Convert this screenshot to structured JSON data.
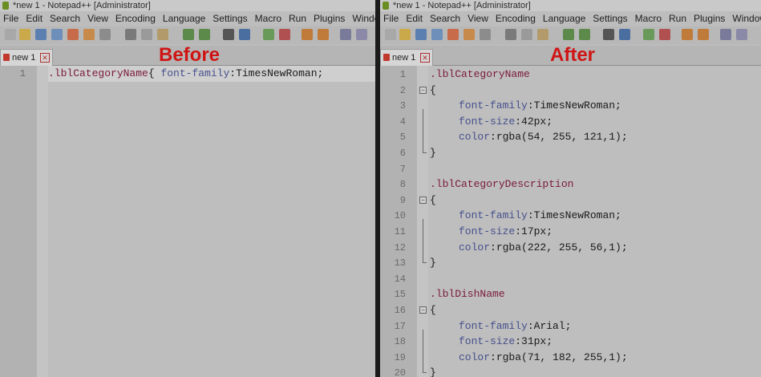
{
  "left": {
    "title": "*new  1 - Notepad++ [Administrator]",
    "menus": [
      "File",
      "Edit",
      "Search",
      "View",
      "Encoding",
      "Language",
      "Settings",
      "Macro",
      "Run",
      "Plugins",
      "Window"
    ],
    "tab": {
      "label": "new  1",
      "close": "✕"
    },
    "caption": "Before",
    "lines": [
      {
        "n": "1",
        "sel": ".lblCategoryName",
        "rest": "{ ",
        "prop": "font-family",
        "colon": ":",
        "val": "TimesNewRoman;"
      }
    ]
  },
  "right": {
    "title": "*new  1 - Notepad++ [Administrator]",
    "menus": [
      "File",
      "Edit",
      "Search",
      "View",
      "Encoding",
      "Language",
      "Settings",
      "Macro",
      "Run",
      "Plugins",
      "Window"
    ],
    "tab": {
      "label": "new  1",
      "close": "✕"
    },
    "caption": "After",
    "fold_open": "−",
    "lines": [
      {
        "n": "1",
        "type": "sel",
        "text": ".lblCategoryName"
      },
      {
        "n": "2",
        "type": "brace",
        "text": "{"
      },
      {
        "n": "3",
        "type": "decl",
        "prop": "font-family",
        "val": "TimesNewRoman;"
      },
      {
        "n": "4",
        "type": "decl",
        "prop": "font-size",
        "val": "42px;"
      },
      {
        "n": "5",
        "type": "decl",
        "prop": "color",
        "val": "rgba(54, 255, 121,1);"
      },
      {
        "n": "6",
        "type": "brace",
        "text": "}"
      },
      {
        "n": "7",
        "type": "blank",
        "text": ""
      },
      {
        "n": "8",
        "type": "sel",
        "text": ".lblCategoryDescription"
      },
      {
        "n": "9",
        "type": "brace",
        "text": "{"
      },
      {
        "n": "10",
        "type": "decl",
        "prop": "font-family",
        "val": "TimesNewRoman;"
      },
      {
        "n": "11",
        "type": "decl",
        "prop": "font-size",
        "val": "17px;"
      },
      {
        "n": "12",
        "type": "decl",
        "prop": "color",
        "val": "rgba(222, 255, 56,1);"
      },
      {
        "n": "13",
        "type": "brace",
        "text": "}"
      },
      {
        "n": "14",
        "type": "blank",
        "text": ""
      },
      {
        "n": "15",
        "type": "sel",
        "text": ".lblDishName"
      },
      {
        "n": "16",
        "type": "brace",
        "text": "{"
      },
      {
        "n": "17",
        "type": "decl",
        "prop": "font-family",
        "val": "Arial;"
      },
      {
        "n": "18",
        "type": "decl",
        "prop": "font-size",
        "val": "31px;"
      },
      {
        "n": "19",
        "type": "decl",
        "prop": "color",
        "val": "rgba(71, 182, 255,1);"
      },
      {
        "n": "20",
        "type": "brace",
        "text": "}"
      }
    ]
  },
  "colors": {
    "caption": "#d01414",
    "selector": "#7a1a3a",
    "property": "#46508c"
  }
}
